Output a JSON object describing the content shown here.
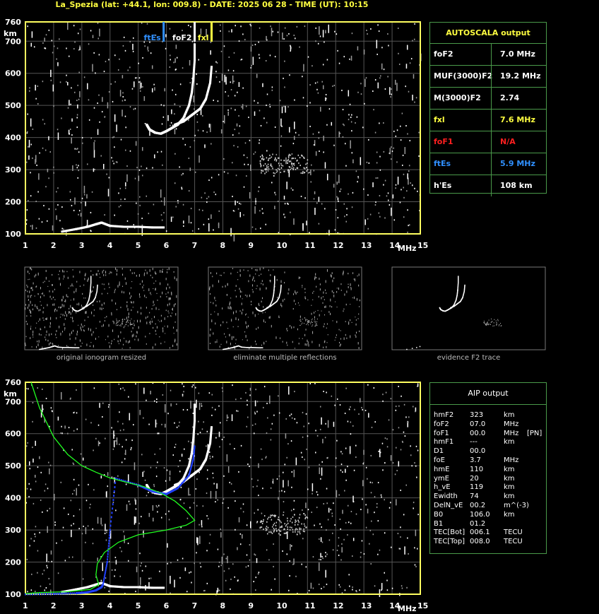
{
  "header": {
    "title": "La_Spezia (lat: +44.1, lon: 009.8) - DATE: 2025 06 28 - TIME (UT): 10:15"
  },
  "colors": {
    "axis": "#ffff60",
    "grid": "#555555",
    "label_white": "#ffffff",
    "fxl": "#ffff40",
    "foF1": "#ff2020",
    "ftEs": "#3090ff",
    "profile": "#20ff20",
    "model": "#2040ff"
  },
  "autoscala": {
    "title": "AUTOSCALA output",
    "rows": [
      {
        "label": "foF2",
        "value": "7.0 MHz",
        "color": "#ffffff"
      },
      {
        "label": "MUF(3000)F2",
        "value": "19.2 MHz",
        "color": "#ffffff"
      },
      {
        "label": "M(3000)F2",
        "value": "2.74",
        "color": "#ffffff"
      },
      {
        "label": "fxl",
        "value": "7.6 MHz",
        "color": "#ffff40"
      },
      {
        "label": "foF1",
        "value": "N/A",
        "color": "#ff2020"
      },
      {
        "label": "ftEs",
        "value": "5.9 MHz",
        "color": "#3090ff"
      },
      {
        "label": "h'Es",
        "value": "108     km",
        "color": "#ffffff"
      }
    ]
  },
  "aip": {
    "title": "AIP output",
    "rows": [
      [
        "hmF2",
        "323",
        "km",
        ""
      ],
      [
        "foF2",
        "07.0",
        "MHz",
        ""
      ],
      [
        "foF1",
        "00.0",
        "MHz",
        "[PN]"
      ],
      [
        "hmF1",
        "---",
        "km",
        ""
      ],
      [
        "D1",
        "00.0",
        "",
        ""
      ],
      [
        "foE",
        "3.7",
        "MHz",
        ""
      ],
      [
        "hmE",
        "110",
        "km",
        ""
      ],
      [
        "ymE",
        "20",
        "km",
        ""
      ],
      [
        "h_vE",
        "119",
        "km",
        ""
      ],
      [
        "Ewidth",
        "74",
        "km",
        ""
      ],
      [
        "DelN_vE",
        "00.2",
        "m^(-3)",
        ""
      ],
      [
        "B0",
        "106.0",
        "km",
        ""
      ],
      [
        "B1",
        "01.2",
        "",
        ""
      ],
      [
        "TEC[Bot]",
        "006.1",
        "TECU",
        ""
      ],
      [
        "TEC[Top]",
        "008.0",
        "TECU",
        ""
      ]
    ]
  },
  "captions": {
    "c1": "original ionogram resized",
    "c2": "eliminate multiple reflections",
    "c3": "evidence F2 trace"
  },
  "markers": {
    "ftEs": "ftEs",
    "foF2": "foF2",
    "fxl": "fxl"
  },
  "chart_data": [
    {
      "type": "scatter",
      "title": "",
      "xlabel": "MHz",
      "ylabel": "km",
      "xlim": [
        1,
        15
      ],
      "ylim": [
        100,
        760
      ],
      "xticks": [
        1,
        2,
        3,
        4,
        5,
        6,
        7,
        8,
        9,
        10,
        11,
        12,
        13,
        14,
        15
      ],
      "yticks": [
        100,
        200,
        300,
        400,
        500,
        600,
        700,
        760
      ],
      "grid": true,
      "markers": [
        {
          "name": "ftEs",
          "x": 5.9
        },
        {
          "name": "foF2",
          "x": 7.0
        },
        {
          "name": "fxl",
          "x": 7.6
        }
      ],
      "series": [
        {
          "name": "O-trace",
          "points": [
            [
              5.3,
              440
            ],
            [
              5.4,
              425
            ],
            [
              5.6,
              415
            ],
            [
              5.8,
              412
            ],
            [
              6.0,
              420
            ],
            [
              6.2,
              430
            ],
            [
              6.4,
              440
            ],
            [
              6.6,
              460
            ],
            [
              6.8,
              500
            ],
            [
              6.9,
              540
            ],
            [
              6.95,
              580
            ],
            [
              7.0,
              640
            ],
            [
              7.0,
              690
            ]
          ]
        },
        {
          "name": "X-trace",
          "points": [
            [
              6.3,
              440
            ],
            [
              6.6,
              450
            ],
            [
              6.9,
              470
            ],
            [
              7.2,
              490
            ],
            [
              7.4,
              520
            ],
            [
              7.55,
              570
            ],
            [
              7.6,
              620
            ]
          ]
        },
        {
          "name": "Es-trace",
          "points": [
            [
              2.3,
              107
            ],
            [
              2.8,
              115
            ],
            [
              3.2,
              122
            ],
            [
              3.5,
              130
            ],
            [
              3.7,
              135
            ],
            [
              4.0,
              125
            ],
            [
              4.5,
              122
            ],
            [
              5.0,
              122
            ],
            [
              5.5,
              120
            ],
            [
              5.9,
              120
            ]
          ]
        }
      ]
    },
    {
      "type": "line",
      "title": "",
      "xlabel": "MHz",
      "ylabel": "km",
      "xlim": [
        1,
        15
      ],
      "ylim": [
        100,
        760
      ],
      "xticks": [
        1,
        2,
        3,
        4,
        5,
        6,
        7,
        8,
        9,
        10,
        11,
        12,
        13,
        14,
        15
      ],
      "yticks": [
        100,
        200,
        300,
        400,
        500,
        600,
        700,
        760
      ],
      "grid": true,
      "series": [
        {
          "name": "profile",
          "points": [
            [
              1.2,
              760
            ],
            [
              1.5,
              680
            ],
            [
              2.0,
              590
            ],
            [
              2.5,
              535
            ],
            [
              3.0,
              500
            ],
            [
              3.5,
              480
            ],
            [
              4.0,
              462
            ],
            [
              4.6,
              448
            ],
            [
              5.2,
              435
            ],
            [
              5.8,
              415
            ],
            [
              6.3,
              390
            ],
            [
              6.7,
              360
            ],
            [
              7.0,
              330
            ],
            [
              6.7,
              315
            ],
            [
              6.0,
              300
            ],
            [
              5.0,
              285
            ],
            [
              4.3,
              262
            ],
            [
              3.8,
              230
            ],
            [
              3.55,
              195
            ],
            [
              3.5,
              160
            ],
            [
              3.6,
              130
            ],
            [
              3.3,
              115
            ],
            [
              2.5,
              108
            ],
            [
              1.5,
              105
            ],
            [
              1.0,
              102
            ]
          ]
        },
        {
          "name": "model",
          "points": [
            [
              1.0,
              100
            ],
            [
              2.0,
              101
            ],
            [
              2.8,
              103
            ],
            [
              3.2,
              106
            ],
            [
              3.5,
              112
            ],
            [
              3.7,
              122
            ],
            [
              3.75,
              130
            ],
            [
              3.9,
              200
            ],
            [
              4.0,
              300
            ],
            [
              4.2,
              460
            ],
            [
              5.0,
              440
            ],
            [
              5.5,
              420
            ],
            [
              6.0,
              412
            ],
            [
              6.4,
              430
            ],
            [
              6.8,
              470
            ],
            [
              6.95,
              520
            ],
            [
              7.0,
              560
            ]
          ]
        }
      ]
    }
  ]
}
